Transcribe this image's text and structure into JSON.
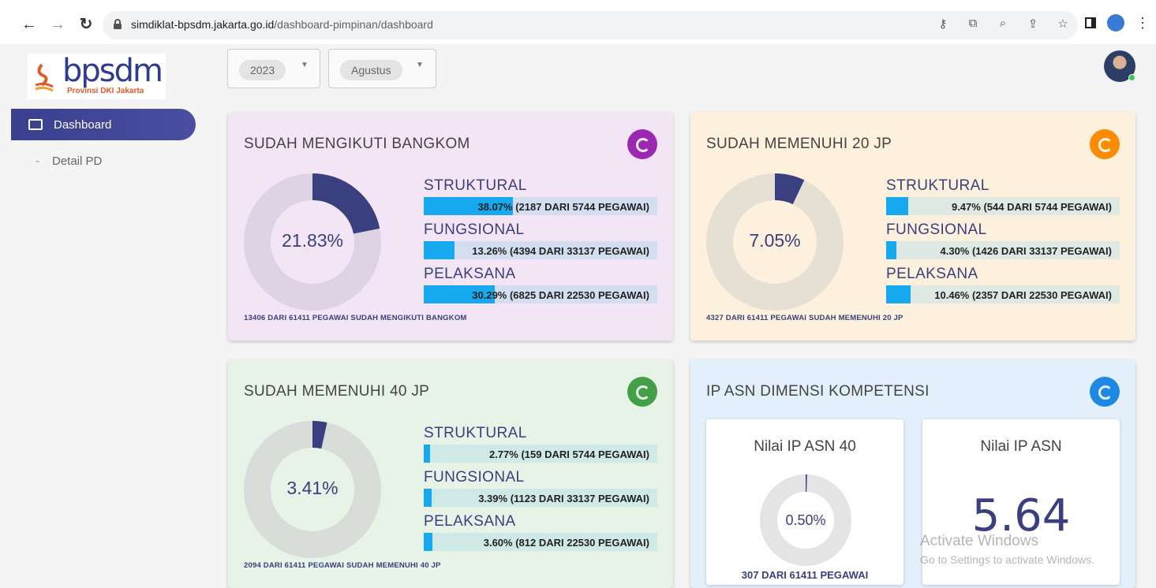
{
  "browser": {
    "url_host": "simdiklat-bpsdm.jakarta.go.id",
    "url_path": "/dashboard-pimpinan/dashboard"
  },
  "logo": {
    "text": "bpsdm",
    "subtitle": "Provinsi DKI Jakarta"
  },
  "sidebar": {
    "items": [
      {
        "label": "Dashboard",
        "active": true
      },
      {
        "label": "Detail PD",
        "active": false
      }
    ]
  },
  "filters": {
    "year": "2023",
    "month": "Agustus"
  },
  "cards": [
    {
      "title": "SUDAH MENGIKUTI BANGKOM",
      "percent_label": "21.83%",
      "percent": 21.83,
      "bg": "#f3e5f5",
      "ring": "#ddd3e4",
      "track": "#d3def1",
      "badge_color": "#9c27b0",
      "rows": [
        {
          "category": "STRUKTURAL",
          "text": "38.07% (2187 DARI 5744 PEGAWAI)",
          "percent": 38.07
        },
        {
          "category": "FUNGSIONAL",
          "text": "13.26% (4394 DARI 33137 PEGAWAI)",
          "percent": 13.26
        },
        {
          "category": "PELAKSANA",
          "text": "30.29% (6825 DARI 22530 PEGAWAI)",
          "percent": 30.29
        }
      ],
      "footer": "13406 DARI 61411 PEGAWAI SUDAH MENGIKUTI BANGKOM"
    },
    {
      "title": "SUDAH MEMENUHI 20 JP",
      "percent_label": "7.05%",
      "percent": 7.05,
      "bg": "#fdf0dc",
      "ring": "#e6dfd3",
      "track": "#dde9e2",
      "badge_color": "#fb8c00",
      "rows": [
        {
          "category": "STRUKTURAL",
          "text": "9.47% (544 DARI 5744 PEGAWAI)",
          "percent": 9.47
        },
        {
          "category": "FUNGSIONAL",
          "text": "4.30% (1426 DARI 33137 PEGAWAI)",
          "percent": 4.3
        },
        {
          "category": "PELAKSANA",
          "text": "10.46% (2357 DARI 22530 PEGAWAI)",
          "percent": 10.46
        }
      ],
      "footer": "4327 DARI 61411 PEGAWAI SUDAH MEMENUHI 20 JP"
    },
    {
      "title": "SUDAH MEMENUHI 40 JP",
      "percent_label": "3.41%",
      "percent": 3.41,
      "bg": "#e6f3e6",
      "ring": "#d9ddd9",
      "track": "#cfe9e6",
      "badge_color": "#43a047",
      "rows": [
        {
          "category": "STRUKTURAL",
          "text": "2.77% (159 DARI 5744 PEGAWAI)",
          "percent": 2.77
        },
        {
          "category": "FUNGSIONAL",
          "text": "3.39% (1123 DARI 33137 PEGAWAI)",
          "percent": 3.39
        },
        {
          "category": "PELAKSANA",
          "text": "3.60% (812 DARI 22530 PEGAWAI)",
          "percent": 3.6
        }
      ],
      "footer": "2094 DARI 61411 PEGAWAI SUDAH MEMENUHI 40 JP"
    }
  ],
  "ip_card": {
    "title": "IP ASN DIMENSI KOMPETENSI",
    "bg": "#e3effa",
    "badge_color": "#1e88e5",
    "ip40": {
      "title": "Nilai IP ASN 40",
      "percent_label": "0.50%",
      "percent": 0.5,
      "footer": "307 DARI 61411 PEGAWAI"
    },
    "ip": {
      "title": "Nilai IP ASN",
      "value": "5.64"
    }
  },
  "colors": {
    "accent": "#3a3f80",
    "bar": "#17a9ef"
  },
  "watermark": {
    "line1": "Activate Windows",
    "line2": "Go to Settings to activate Windows."
  }
}
